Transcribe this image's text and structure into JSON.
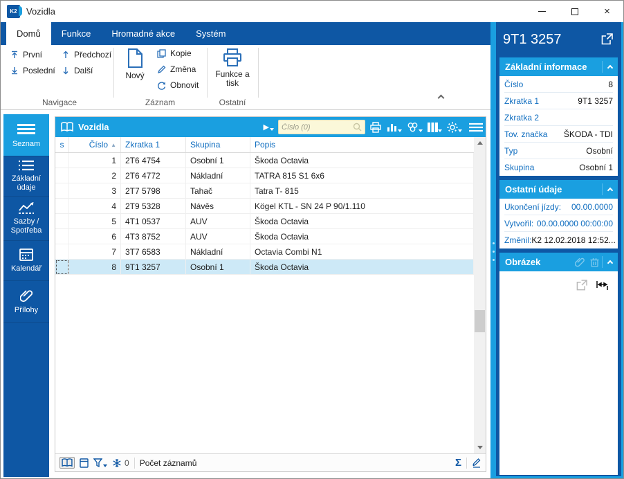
{
  "colors": {
    "dark_blue": "#0E57A4",
    "bright_blue": "#1A9FE0",
    "selected_row_bg": "#CDE9F7",
    "label_blue": "#0D6CBF",
    "search_bg": "#FBF8D9"
  },
  "icons": {
    "sort_ascending": "▲",
    "play": "▶",
    "close": "×",
    "arrow_up": "↑",
    "arrow_down": "↓"
  },
  "window": {
    "title": "Vozidla"
  },
  "ribbon": {
    "tabs": [
      {
        "label": "Domů",
        "active": true
      },
      {
        "label": "Funkce",
        "active": false
      },
      {
        "label": "Hromadné akce",
        "active": false
      },
      {
        "label": "Systém",
        "active": false
      }
    ],
    "navigace": {
      "label": "Navigace",
      "first": "První",
      "last": "Poslední",
      "prev": "Předchozí",
      "next": "Další"
    },
    "zaznam": {
      "label": "Záznam",
      "new": "Nový",
      "copy": "Kopie",
      "change": "Změna",
      "refresh": "Obnovit"
    },
    "ostatni": {
      "label": "Ostatní",
      "print": "Funkce a tisk"
    }
  },
  "sidebar": {
    "items": [
      {
        "label": "Seznam",
        "active": true
      },
      {
        "label": "Základní údaje",
        "active": false
      },
      {
        "label": "Sazby / Spotřeba",
        "active": false
      },
      {
        "label": "Kalendář",
        "active": false
      },
      {
        "label": "Přílohy",
        "active": false
      }
    ]
  },
  "grid": {
    "title": "Vozidla",
    "search_placeholder": "Číslo (0)",
    "columns": {
      "s": "s",
      "cislo": "Číslo",
      "zkratka": "Zkratka 1",
      "skupina": "Skupina",
      "popis": "Popis"
    },
    "rows": [
      {
        "cislo": "1",
        "zkratka": "2T6 4754",
        "skupina": "Osobní 1",
        "popis": "Škoda Octavia"
      },
      {
        "cislo": "2",
        "zkratka": "2T6 4772",
        "skupina": "Nákladní",
        "popis": "TATRA 815 S1 6x6"
      },
      {
        "cislo": "3",
        "zkratka": "2T7 5798",
        "skupina": "Tahač",
        "popis": "Tatra T- 815"
      },
      {
        "cislo": "4",
        "zkratka": "2T9 5328",
        "skupina": "Návěs",
        "popis": "Kögel KTL - SN 24 P 90/1.110"
      },
      {
        "cislo": "5",
        "zkratka": "4T1 0537",
        "skupina": "AUV",
        "popis": "Škoda Octavia"
      },
      {
        "cislo": "6",
        "zkratka": "4T3 8752",
        "skupina": "AUV",
        "popis": "Škoda Octavia"
      },
      {
        "cislo": "7",
        "zkratka": "3T7 6583",
        "skupina": "Nákladní",
        "popis": "Octavia Combi N1"
      },
      {
        "cislo": "8",
        "zkratka": "9T1 3257",
        "skupina": "Osobní 1",
        "popis": "Škoda Octavia"
      }
    ],
    "selected_row_index": 7,
    "status": {
      "flag_count": "0",
      "label": "Počet záznamů"
    }
  },
  "detail": {
    "title": "9T1 3257",
    "basic": {
      "header": "Základní informace",
      "fields": [
        {
          "label": "Číslo",
          "value": "8"
        },
        {
          "label": "Zkratka 1",
          "value": "9T1 3257"
        },
        {
          "label": "Zkratka 2",
          "value": ""
        },
        {
          "label": "Tov. značka",
          "value": "ŠKODA - TDI"
        },
        {
          "label": "Typ",
          "value": "Osobní"
        },
        {
          "label": "Skupina",
          "value": "Osobní 1"
        }
      ]
    },
    "other": {
      "header": "Ostatní údaje",
      "fields": [
        {
          "label": "Ukončení jízdy:",
          "value": "00.00.0000"
        },
        {
          "label": "Vytvořil:",
          "value": "00.00.0000 00:00:00"
        },
        {
          "label": "Změnil:",
          "value": "K2 12.02.2018 12:52..."
        }
      ]
    },
    "image": {
      "header": "Obrázek"
    }
  }
}
